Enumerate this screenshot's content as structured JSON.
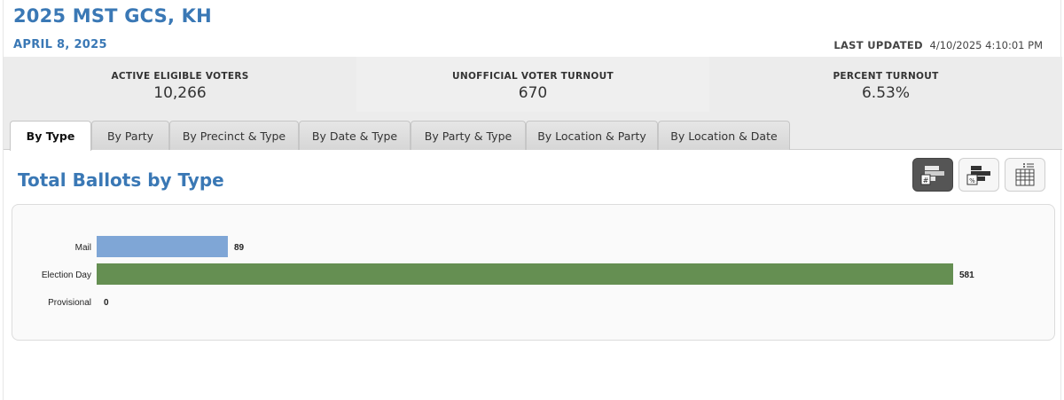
{
  "header": {
    "title": "2025 MST GCS, KH",
    "date": "APRIL 8, 2025",
    "last_updated_label": "LAST UPDATED",
    "last_updated_value": "4/10/2025 4:10:01 PM"
  },
  "stats": [
    {
      "label": "ACTIVE ELIGIBLE VOTERS",
      "value": "10,266"
    },
    {
      "label": "UNOFFICIAL VOTER TURNOUT",
      "value": "670"
    },
    {
      "label": "PERCENT TURNOUT",
      "value": "6.53%"
    }
  ],
  "tabs": [
    {
      "label": "By Type"
    },
    {
      "label": "By Party"
    },
    {
      "label": "By Precinct & Type"
    },
    {
      "label": "By Date & Type"
    },
    {
      "label": "By Party & Type"
    },
    {
      "label": "By Location & Party"
    },
    {
      "label": "By Location & Date"
    }
  ],
  "active_tab": "By Type",
  "section": {
    "title": "Total Ballots by Type"
  },
  "view_buttons": [
    {
      "icon": "count-bar-icon",
      "active": true
    },
    {
      "icon": "percent-bar-icon",
      "active": false
    },
    {
      "icon": "table-icon",
      "active": false
    }
  ],
  "chart_data": {
    "type": "bar",
    "orientation": "horizontal",
    "categories": [
      "Mail",
      "Election Day",
      "Provisional"
    ],
    "values": [
      89,
      581,
      0
    ],
    "colors": [
      "#7fa6d6",
      "#658f52",
      "#b0b0b0"
    ],
    "title": "",
    "xlabel": "",
    "ylabel": "",
    "xlim": [
      0,
      581
    ],
    "grid": false,
    "data_labels": true
  }
}
